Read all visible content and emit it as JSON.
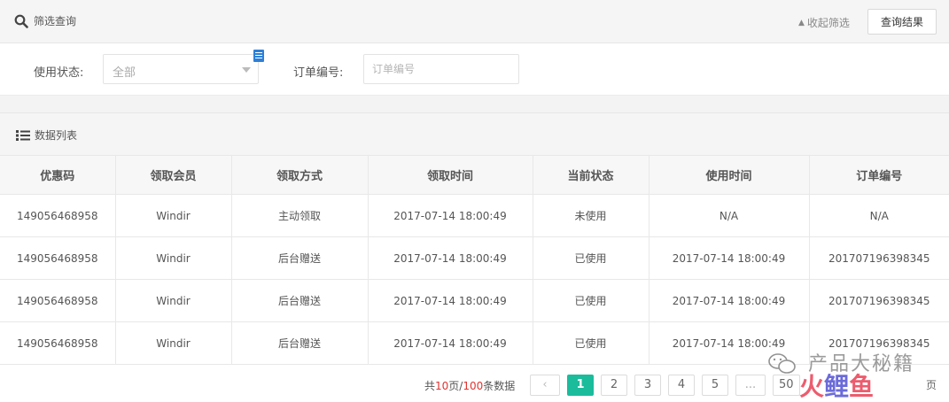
{
  "filter": {
    "title": "筛选查询",
    "collapse_label": "收起筛选",
    "query_button": "查询结果",
    "status_label": "使用状态:",
    "status_value": "全部",
    "order_label": "订单编号:",
    "order_placeholder": "订单编号"
  },
  "list": {
    "title": "数据列表"
  },
  "table": {
    "headers": [
      "优惠码",
      "领取会员",
      "领取方式",
      "领取时间",
      "当前状态",
      "使用时间",
      "订单编号"
    ],
    "rows": [
      [
        "149056468958",
        "Windir",
        "主动领取",
        "2017-07-14 18:00:49",
        "未使用",
        "N/A",
        "N/A"
      ],
      [
        "149056468958",
        "Windir",
        "后台赠送",
        "2017-07-14 18:00:49",
        "已使用",
        "2017-07-14 18:00:49",
        "201707196398345"
      ],
      [
        "149056468958",
        "Windir",
        "后台赠送",
        "2017-07-14 18:00:49",
        "已使用",
        "2017-07-14 18:00:49",
        "201707196398345"
      ],
      [
        "149056468958",
        "Windir",
        "后台赠送",
        "2017-07-14 18:00:49",
        "已使用",
        "2017-07-14 18:00:49",
        "201707196398345"
      ]
    ]
  },
  "pagination": {
    "info_prefix": "共",
    "total_pages": "10",
    "info_mid": "页/",
    "total_items": "100",
    "info_suffix": "条数据",
    "prev": "‹",
    "pages": [
      "1",
      "2",
      "3",
      "4",
      "5"
    ],
    "ellipsis": "...",
    "last_page": "50",
    "current": "1"
  },
  "watermark": {
    "text": "产品大秘籍",
    "logo_1": "火",
    "logo_2": "鲤",
    "logo_3": "鱼",
    "tail": "页"
  },
  "colors": {
    "accent": "#1abc9c",
    "highlight_red": "#e0332f",
    "badge_blue": "#2d7fd8"
  }
}
